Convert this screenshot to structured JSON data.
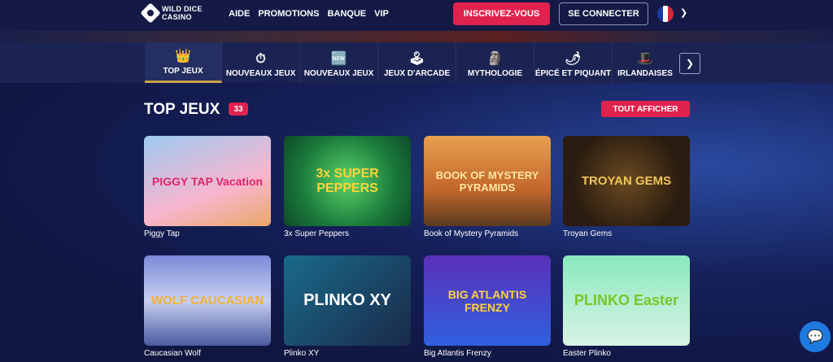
{
  "header": {
    "logo_line1": "WILD DICE",
    "logo_line2": "CASINO",
    "nav": [
      "AIDE",
      "PROMOTIONS",
      "BANQUE",
      "VIP"
    ],
    "signup_label": "INSCRIVEZ-VOUS",
    "login_label": "SE CONNECTER",
    "language_flag": "fr-flag-icon"
  },
  "categories": [
    {
      "label": "TOP JEUX",
      "icon": "crown-icon",
      "glyph": "👑"
    },
    {
      "label": "NOUVEAUX JEUX",
      "icon": "stopwatch-icon",
      "glyph": "⏱"
    },
    {
      "label": "NOUVEAUX JEUX",
      "icon": "new-badge-icon",
      "glyph": "🆕"
    },
    {
      "label": "JEUX D'ARCADE",
      "icon": "joystick-icon",
      "glyph": "🕹"
    },
    {
      "label": "MYTHOLOGIE",
      "icon": "pharaoh-icon",
      "glyph": "🗿"
    },
    {
      "label": "ÉPICÉ ET PIQUANT",
      "icon": "chili-pepper-icon",
      "glyph": "🌶"
    },
    {
      "label": "IRLANDAISES",
      "icon": "leprechaun-hat-icon",
      "glyph": "🎩"
    }
  ],
  "section": {
    "title": "TOP JEUX",
    "count": "33",
    "show_all_label": "TOUT AFFICHER"
  },
  "games": [
    {
      "name": "Piggy Tap",
      "art": "PIGGY TAP Vacation"
    },
    {
      "name": "3x Super Peppers",
      "art": "3x SUPER PEPPERS"
    },
    {
      "name": "Book of Mystery Pyramids",
      "art": "BOOK OF MYSTERY PYRAMIDS"
    },
    {
      "name": "Troyan Gems",
      "art": "TROYAN GEMS"
    },
    {
      "name": "Caucasian Wolf",
      "art": "WOLF CAUCASIAN"
    },
    {
      "name": "Plinko XY",
      "art": "PLINKO XY"
    },
    {
      "name": "Big Atlantis Frenzy",
      "art": "BIG ATLANTIS FRENZY"
    },
    {
      "name": "Easter Plinko",
      "art": "PLINKO Easter"
    }
  ]
}
